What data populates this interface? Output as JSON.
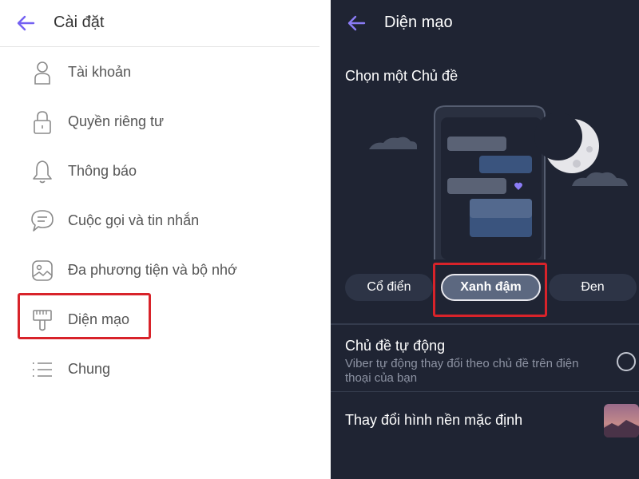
{
  "left": {
    "title": "Cài đặt",
    "items": [
      {
        "label": "Tài khoản",
        "icon": "person-icon"
      },
      {
        "label": "Quyền riêng tư",
        "icon": "lock-icon"
      },
      {
        "label": "Thông báo",
        "icon": "bell-icon"
      },
      {
        "label": "Cuộc gọi và tin nhắn",
        "icon": "chat-icon"
      },
      {
        "label": "Đa phương tiện và bộ nhớ",
        "icon": "media-icon"
      },
      {
        "label": "Diện mạo",
        "icon": "brush-icon"
      },
      {
        "label": "Chung",
        "icon": "list-icon"
      }
    ]
  },
  "right": {
    "title": "Diện mạo",
    "choose_label": "Chọn một Chủ đề",
    "themes": [
      {
        "label": "Cổ điển",
        "selected": false
      },
      {
        "label": "Xanh đậm",
        "selected": true
      },
      {
        "label": "Đen",
        "selected": false
      }
    ],
    "auto_theme": {
      "title": "Chủ đề tự động",
      "description": "Viber tự động thay đổi theo chủ đề trên điện thoại của bạn",
      "enabled": false
    },
    "wallpaper_label": "Thay đổi hình nền mặc định"
  },
  "colors": {
    "accent": "#7360f2",
    "highlight": "#d8232a",
    "dark_background": "#1f2433",
    "selected_theme": "#5c6880"
  }
}
